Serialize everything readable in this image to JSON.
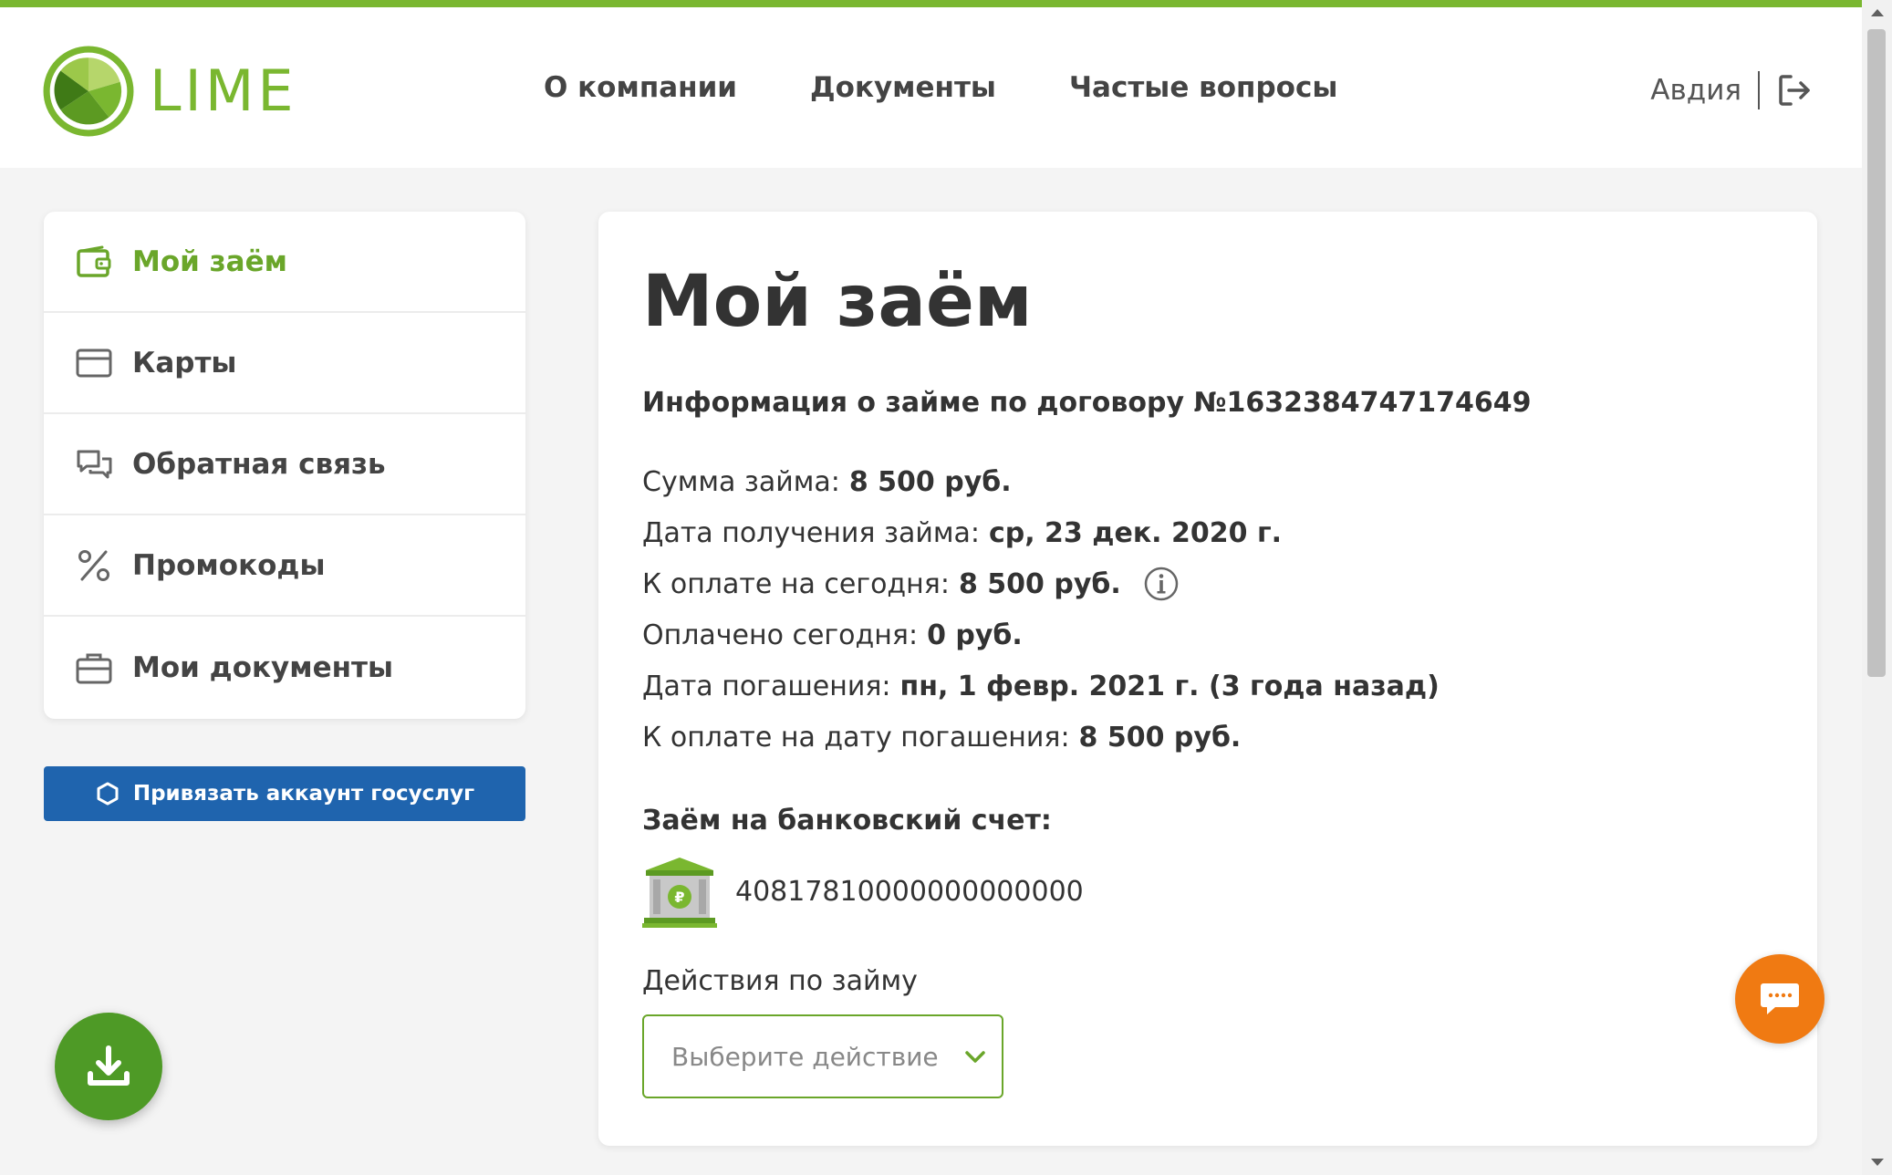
{
  "brand": {
    "name": "LIME",
    "color": "#7ab730"
  },
  "nav": {
    "items": [
      {
        "label": "О компании"
      },
      {
        "label": "Документы"
      },
      {
        "label": "Частые вопросы"
      }
    ]
  },
  "user": {
    "name": "Авдия",
    "logout_icon": "logout-icon"
  },
  "sidebar": {
    "items": [
      {
        "label": "Мой заём",
        "icon": "wallet-icon",
        "active": true
      },
      {
        "label": "Карты",
        "icon": "card-icon"
      },
      {
        "label": "Обратная связь",
        "icon": "chat-bubbles-icon"
      },
      {
        "label": "Промокоды",
        "icon": "percent-icon"
      },
      {
        "label": "Мои документы",
        "icon": "briefcase-icon"
      }
    ],
    "gosuslugi_button": "Привязать аккаунт госуслуг",
    "gosuslugi_color": "#1f64ae"
  },
  "main": {
    "title": "Мой заём",
    "contract_info": "Информация о займе по договору №1632384747174649",
    "facts": [
      {
        "label": "Сумма займа:",
        "value": "8 500 руб."
      },
      {
        "label": "Дата получения займа:",
        "value": "ср, 23 дек. 2020 г."
      },
      {
        "label": "К оплате на сегодня:",
        "value": "8 500 руб.",
        "info_icon": "info-icon"
      },
      {
        "label": "Оплачено сегодня:",
        "value": "0 руб."
      },
      {
        "label": "Дата погашения:",
        "value": "пн, 1 февр. 2021 г. (3 года назад)"
      },
      {
        "label": "К оплате на дату погашения:",
        "value": "8 500 руб."
      }
    ],
    "bank_title": "Заём на банковский счет:",
    "bank_icon": "bank-building-icon",
    "account_number": "40817810000000000000",
    "actions_label": "Действия по займу",
    "actions_select": {
      "placeholder": "Выберите действие"
    }
  },
  "floating": {
    "chat_icon": "chat-icon",
    "chat_color": "#f07a12",
    "download_icon": "download-icon",
    "download_color": "#4e9a26"
  }
}
